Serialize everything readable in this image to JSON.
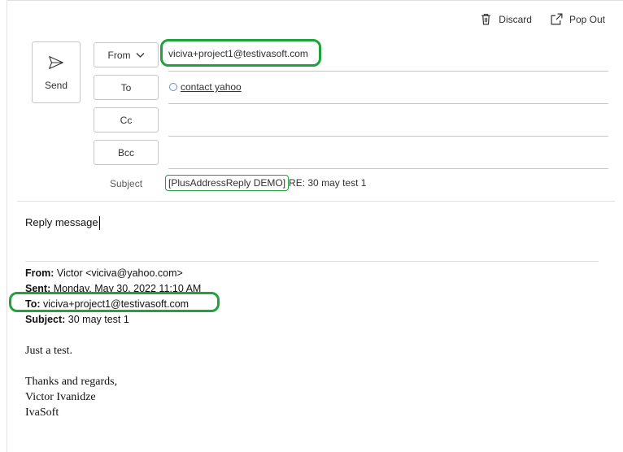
{
  "toolbar": {
    "discard_label": "Discard",
    "popout_label": "Pop Out"
  },
  "compose": {
    "send_label": "Send",
    "from_label": "From",
    "to_label": "To",
    "cc_label": "Cc",
    "bcc_label": "Bcc",
    "from_address": "viciva+project1@testivasoft.com",
    "to_contact": "contact yahoo",
    "subject_label": "Subject",
    "subject_tag": "[PlusAddressReply DEMO]",
    "subject_rest": "RE: 30 may test 1"
  },
  "body": {
    "reply_text": "Reply message"
  },
  "quoted": {
    "from_label": "From:",
    "from_value": " Victor <viciva@yahoo.com>",
    "sent_label": "Sent:",
    "sent_value": " Monday, May 30, 2022 11:10 AM",
    "to_label": "To:",
    "to_value": " viciva+project1@testivasoft.com",
    "subject_label": "Subject:",
    "subject_value": " 30 may test 1",
    "line1": "Just a test.",
    "line2": "Thanks and regards,",
    "line3": "Victor Ivanidze",
    "line4": "IvaSoft"
  },
  "colors": {
    "highlight": "#1fa33a",
    "border": "#c8c6c4"
  }
}
